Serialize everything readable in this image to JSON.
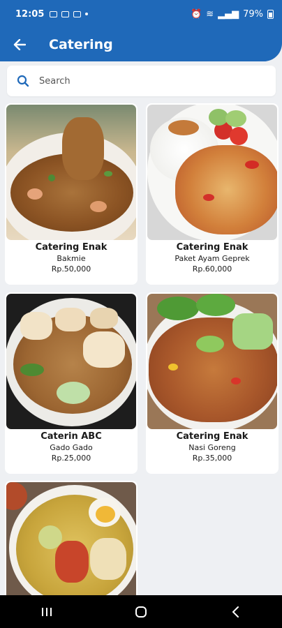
{
  "status_bar": {
    "time": "12:05",
    "battery": "79%"
  },
  "app_bar": {
    "title": "Catering"
  },
  "search": {
    "placeholder": "Search"
  },
  "items": [
    {
      "vendor": "Catering Enak",
      "name": "Bakmie",
      "price": "Rp.50,000"
    },
    {
      "vendor": "Catering Enak",
      "name": "Paket Ayam Geprek",
      "price": "Rp.60,000"
    },
    {
      "vendor": "Caterin ABC",
      "name": "Gado Gado",
      "price": "Rp.25,000"
    },
    {
      "vendor": "Catering Enak",
      "name": "Nasi Goreng",
      "price": "Rp.35,000"
    },
    {
      "vendor": "",
      "name": "",
      "price": ""
    }
  ],
  "colors": {
    "primary": "#1f69b9",
    "background": "#eef0f3"
  },
  "nav_icons": [
    "recents-icon",
    "home-icon",
    "back-icon"
  ]
}
